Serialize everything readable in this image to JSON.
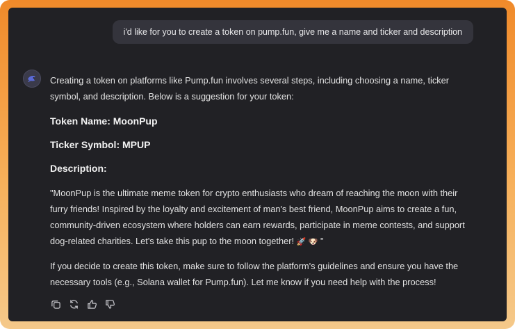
{
  "conversation": {
    "user_message": "i'd like for you to create a token on pump.fun, give me a name and ticker and description",
    "assistant": {
      "intro": "Creating a token on platforms like Pump.fun involves several steps, including choosing a name, ticker symbol, and description. Below is a suggestion for your token:",
      "token_name_label": "Token Name: ",
      "token_name_value": "MoonPup",
      "ticker_label": "Ticker Symbol: ",
      "ticker_value": "MPUP",
      "description_label": "Description:",
      "description_text": "\"MoonPup is the ultimate meme token for crypto enthusiasts who dream of reaching the moon with their furry friends! Inspired by the loyalty and excitement of man's best friend, MoonPup aims to create a fun, community-driven ecosystem where holders can earn rewards, participate in meme contests, and support dog-related charities. Let's take this pup to the moon together!",
      "description_emojis": "🚀 🐶",
      "description_close": " \"",
      "closing": "If you decide to create this token, make sure to follow the platform's guidelines and ensure you have the necessary tools (e.g., Solana wallet for Pump.fun). Let me know if you need help with the process!"
    },
    "action_icons": [
      "copy-icon",
      "regenerate-icon",
      "thumbs-up-icon",
      "thumbs-down-icon"
    ]
  },
  "colors": {
    "background": "#212125",
    "user_bubble": "#34343c",
    "frame_gradient_top": "#f08a2a",
    "frame_gradient_bottom": "#f5c98a"
  }
}
